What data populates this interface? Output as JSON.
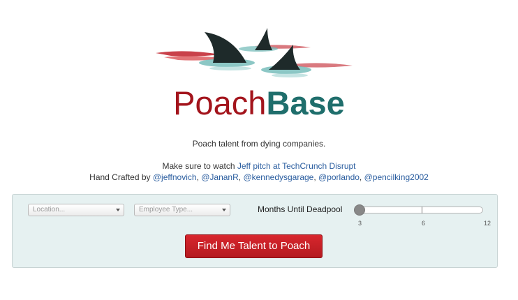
{
  "brand": {
    "part1": "Poach",
    "part2": "Base"
  },
  "tagline": "Poach talent from dying companies.",
  "watch": {
    "prefix": "Make sure to watch ",
    "link1": "Jeff",
    "link2": "pitch at TechCrunch Disrupt"
  },
  "credits": {
    "prefix": "Hand Crafted by ",
    "handles": [
      "@jeffnovich",
      "@JananR",
      "@kennedysgarage",
      "@porlando",
      "@pencilking2002"
    ]
  },
  "search": {
    "location_placeholder": "Location...",
    "employee_type_placeholder": "Employee Type...",
    "slider_label": "Months Until Deadpool",
    "slider_value": 3,
    "slider_ticks": [
      "3",
      "6",
      "12"
    ],
    "button_label": "Find Me Talent to Poach"
  },
  "colors": {
    "brand_red": "#a3141c",
    "brand_teal": "#1f6e6c",
    "panel_bg": "#e6f1f1",
    "link": "#2a5d9f"
  },
  "icons": {
    "logo": "shark-fins-logo",
    "caret": "chevron-down-icon"
  }
}
